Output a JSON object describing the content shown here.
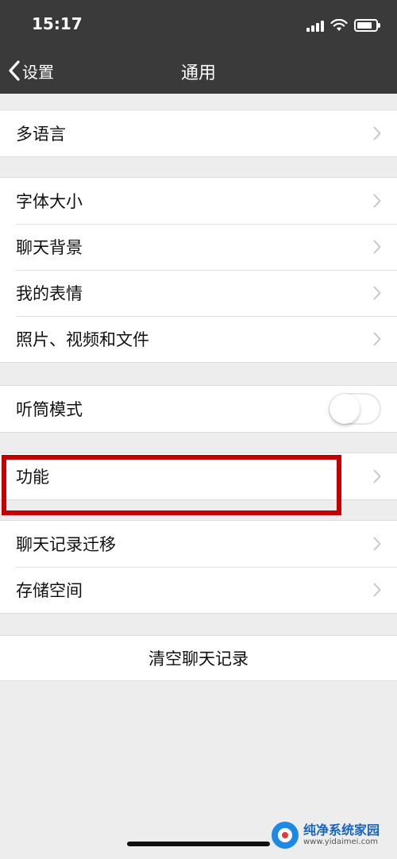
{
  "status_bar": {
    "time": "15:17",
    "icons": [
      "signal-icon",
      "wifi-icon",
      "battery-icon"
    ]
  },
  "nav": {
    "back_label": "设置",
    "title": "通用"
  },
  "groups": [
    {
      "items": [
        {
          "label": "多语言"
        }
      ]
    },
    {
      "items": [
        {
          "label": "字体大小"
        },
        {
          "label": "聊天背景"
        },
        {
          "label": "我的表情"
        },
        {
          "label": "照片、视频和文件"
        }
      ]
    },
    {
      "items": [
        {
          "label": "听筒模式",
          "toggle": false
        }
      ]
    },
    {
      "items": [
        {
          "label": "功能",
          "highlighted": true
        }
      ]
    },
    {
      "items": [
        {
          "label": "聊天记录迁移"
        },
        {
          "label": "存储空间"
        }
      ]
    }
  ],
  "clear_button": {
    "label": "清空聊天记录"
  },
  "watermark": {
    "title": "纯净系统家园",
    "url": "www.yidaimei.com"
  },
  "colors": {
    "header_bg": "#3a3a3a",
    "page_bg": "#ededed",
    "highlight": "#c40000"
  }
}
